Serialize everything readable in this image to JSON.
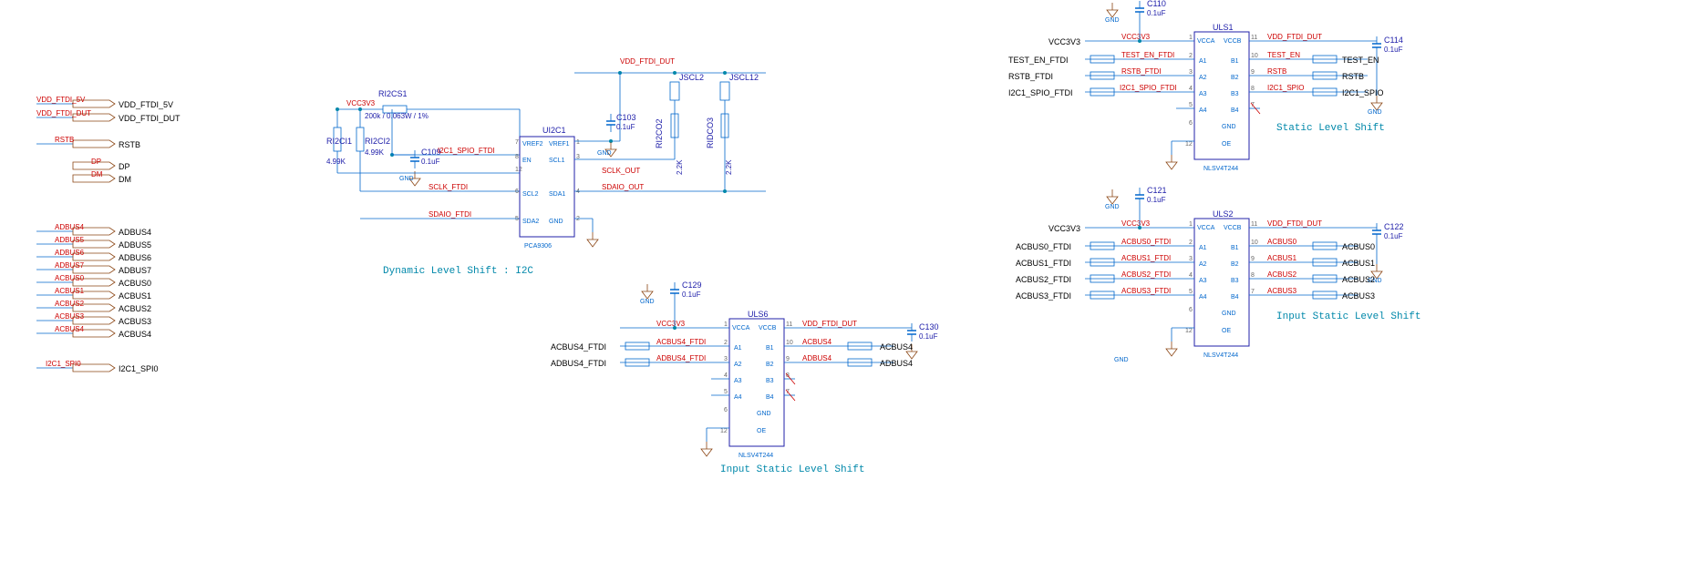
{
  "left_ports": {
    "vdd5v": "VDD_FTDI_5V",
    "vdddut": "VDD_FTDI_DUT",
    "rstb": "RSTB",
    "dp": "DP",
    "dm": "DM",
    "adbus4": "ADBUS4",
    "adbus5": "ADBUS5",
    "adbus6": "ADBUS6",
    "adbus7": "ADBUS7",
    "acbus0": "ACBUS0",
    "acbus1": "ACBUS1",
    "acbus2": "ACBUS2",
    "acbus3": "ACBUS3",
    "acbus4": "ACBUS4",
    "i2c_spio": "I2C1_SPI0"
  },
  "captions": {
    "dyn": "Dynamic Level Shift : I2C",
    "isls": "Input Static Level Shift",
    "sls": "Static Level Shift"
  },
  "i2c_block": {
    "r_cs1": {
      "ref": "RI2CS1",
      "val": "200k / 0.063W / 1%"
    },
    "r_ci1": {
      "ref": "RI2CI1",
      "val": "4.99K"
    },
    "r_ci2": {
      "ref": "RI2CI2",
      "val": "4.99K"
    },
    "c109": {
      "ref": "C109",
      "val": "0.1uF"
    },
    "u": {
      "ref": "UI2C1",
      "part": "PCA9306",
      "pins_l": [
        "VREF2",
        "EN",
        "SCL2",
        "SDA2"
      ],
      "pins_r": [
        "VREF1",
        "SCL1",
        "SDA1",
        "GND"
      ]
    },
    "nets": {
      "vcc": "VCC3V3",
      "vdd": "VDD_FTDI_DUT",
      "sclk_ftdi": "SCLK_FTDI",
      "sdaio_ftdi": "SDAIO_FTDI",
      "spio_ftdi": "I2C1_SPIO_FTDI",
      "sclk_out": "SCLK_OUT",
      "sdaio_out": "SDAIO_OUT"
    },
    "c103": {
      "ref": "C103",
      "val": "0.1uF"
    },
    "j2": "JSCL2",
    "j12": "JSCL12",
    "rdco2": {
      "ref": "RI2CO2",
      "val": "2.2K"
    },
    "rdco3": {
      "ref": "RIDCO3",
      "val": "2.2K"
    }
  },
  "uls6": {
    "ref": "ULS6",
    "part": "NLSV4T244",
    "c_left": {
      "ref": "C129",
      "val": "0.1uF"
    },
    "c_right": {
      "ref": "C130",
      "val": "0.1uF"
    },
    "vcc": "VCC3V3",
    "vdd": "VDD_FTDI_DUT",
    "rows": [
      {
        "l_net": "ACBUS4_FTDI",
        "l_out": "ACBUS4_FTDI",
        "pl": "2",
        "pla": "A1",
        "pra": "B1",
        "pr": "10",
        "r_net": "ACBUS4",
        "r_out": "ACBUS4"
      },
      {
        "l_net": "ADBUS4_FTDI",
        "l_out": "ADBUS4_FTDI",
        "pl": "3",
        "pla": "A2",
        "pra": "B2",
        "pr": "9",
        "r_net": "ADBUS4",
        "r_out": "ADBUS4"
      },
      {
        "l_net": "",
        "l_out": "",
        "pl": "4",
        "pla": "A3",
        "pra": "B3",
        "pr": "8",
        "r_net": "",
        "r_out": ""
      },
      {
        "l_net": "",
        "l_out": "",
        "pl": "5",
        "pla": "A4",
        "pra": "B4",
        "pr": "7",
        "r_net": "",
        "r_out": ""
      }
    ],
    "gnd_pin": "6",
    "oe_pin": "12",
    "vcca": "1",
    "vccb": "11",
    "pwr_l": "VCCA",
    "pwr_r": "VCCB",
    "gnd": "GND",
    "oe": "OE"
  },
  "uls1": {
    "ref": "ULS1",
    "part": "NLSV4T244",
    "c_left": {
      "ref": "C110",
      "val": "0.1uF"
    },
    "c_right": {
      "ref": "C114",
      "val": "0.1uF"
    },
    "vcc": "VCC3V3",
    "vdd": "VDD_FTDI_DUT",
    "rows": [
      {
        "l_net": "TEST_EN_FTDI",
        "l_out": "TEST_EN_FTDI",
        "pl": "2",
        "pla": "A1",
        "pra": "B1",
        "pr": "10",
        "r_net": "TEST_EN",
        "r_out": "TEST_EN"
      },
      {
        "l_net": "RSTB_FTDI",
        "l_out": "RSTB_FTDI",
        "pl": "3",
        "pla": "A2",
        "pra": "B2",
        "pr": "9",
        "r_net": "RSTB",
        "r_out": "RSTB"
      },
      {
        "l_net": "I2C1_SPIO_FTDI",
        "l_out": "I2C1_SPIO_FTDI",
        "pl": "4",
        "pla": "A3",
        "pra": "B3",
        "pr": "8",
        "r_net": "I2C1_SPIO",
        "r_out": "I2C1_SPIO"
      },
      {
        "l_net": "",
        "l_out": "",
        "pl": "5",
        "pla": "A4",
        "pra": "B4",
        "pr": "7",
        "r_net": "",
        "r_out": ""
      }
    ],
    "gnd_pin": "6",
    "oe_pin": "12",
    "vcca": "1",
    "vccb": "11",
    "pwr_l": "VCCA",
    "pwr_r": "VCCB",
    "gnd": "GND",
    "oe": "OE"
  },
  "uls2": {
    "ref": "ULS2",
    "part": "NLSV4T244",
    "c_left": {
      "ref": "C121",
      "val": "0.1uF"
    },
    "c_right": {
      "ref": "C122",
      "val": "0.1uF"
    },
    "vcc": "VCC3V3",
    "vdd": "VDD_FTDI_DUT",
    "rows": [
      {
        "l_net": "ACBUS0_FTDI",
        "l_out": "ACBUS0_FTDI",
        "pl": "2",
        "pla": "A1",
        "pra": "B1",
        "pr": "10",
        "r_net": "ACBUS0",
        "r_out": "ACBUS0"
      },
      {
        "l_net": "ACBUS1_FTDI",
        "l_out": "ACBUS1_FTDI",
        "pl": "3",
        "pla": "A2",
        "pra": "B2",
        "pr": "9",
        "r_net": "ACBUS1",
        "r_out": "ACBUS1"
      },
      {
        "l_net": "ACBUS2_FTDI",
        "l_out": "ACBUS2_FTDI",
        "pl": "4",
        "pla": "A3",
        "pra": "B3",
        "pr": "8",
        "r_net": "ACBUS2",
        "r_out": "ACBUS2"
      },
      {
        "l_net": "ACBUS3_FTDI",
        "l_out": "ACBUS3_FTDI",
        "pl": "5",
        "pla": "A4",
        "pra": "B4",
        "pr": "7",
        "r_net": "ACBUS3",
        "r_out": "ACBUS3"
      }
    ],
    "gnd_pin": "6",
    "oe_pin": "12",
    "vcca": "1",
    "vccb": "11",
    "pwr_l": "VCCA",
    "pwr_r": "VCCB",
    "gnd": "GND",
    "oe": "OE"
  }
}
